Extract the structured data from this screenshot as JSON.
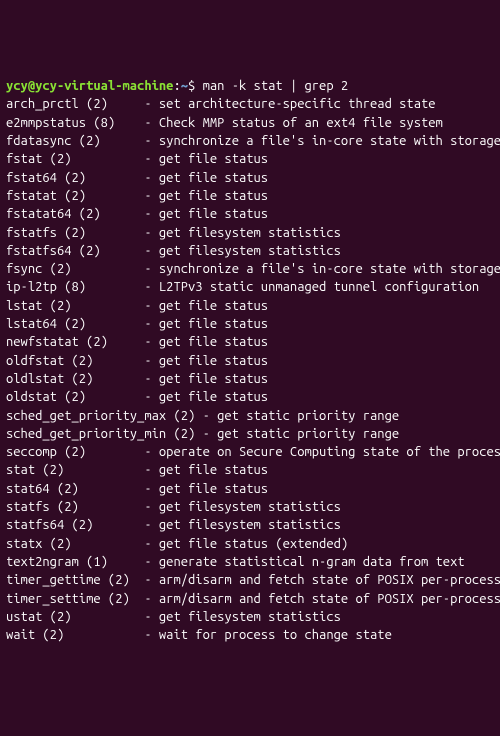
{
  "prompt": {
    "user": "ycy@ycy-virtual-machine",
    "colon": ":",
    "path": "~",
    "dollar": "$ "
  },
  "command": "man -k stat | grep 2",
  "entries": [
    {
      "name": "arch_prctl (2)     ",
      "sep": "- ",
      "desc": "set architecture-specific thread state"
    },
    {
      "name": "e2mmpstatus (8)    ",
      "sep": "- ",
      "desc": "Check MMP status of an ext4 file system"
    },
    {
      "name": "fdatasync (2)      ",
      "sep": "- ",
      "desc": "synchronize a file's in-core state with storage device"
    },
    {
      "name": "fstat (2)          ",
      "sep": "- ",
      "desc": "get file status"
    },
    {
      "name": "fstat64 (2)        ",
      "sep": "- ",
      "desc": "get file status"
    },
    {
      "name": "fstatat (2)        ",
      "sep": "- ",
      "desc": "get file status"
    },
    {
      "name": "fstatat64 (2)      ",
      "sep": "- ",
      "desc": "get file status"
    },
    {
      "name": "fstatfs (2)        ",
      "sep": "- ",
      "desc": "get filesystem statistics"
    },
    {
      "name": "fstatfs64 (2)      ",
      "sep": "- ",
      "desc": "get filesystem statistics"
    },
    {
      "name": "fsync (2)          ",
      "sep": "- ",
      "desc": "synchronize a file's in-core state with storage device"
    },
    {
      "name": "ip-l2tp (8)        ",
      "sep": "- ",
      "desc": "L2TPv3 static unmanaged tunnel configuration"
    },
    {
      "name": "lstat (2)          ",
      "sep": "- ",
      "desc": "get file status"
    },
    {
      "name": "lstat64 (2)        ",
      "sep": "- ",
      "desc": "get file status"
    },
    {
      "name": "newfstatat (2)     ",
      "sep": "- ",
      "desc": "get file status"
    },
    {
      "name": "oldfstat (2)       ",
      "sep": "- ",
      "desc": "get file status"
    },
    {
      "name": "oldlstat (2)       ",
      "sep": "- ",
      "desc": "get file status"
    },
    {
      "name": "oldstat (2)        ",
      "sep": "- ",
      "desc": "get file status"
    },
    {
      "name": "sched_get_priority_max (2) ",
      "sep": "- ",
      "desc": "get static priority range"
    },
    {
      "name": "sched_get_priority_min (2) ",
      "sep": "- ",
      "desc": "get static priority range"
    },
    {
      "name": "seccomp (2)        ",
      "sep": "- ",
      "desc": "operate on Secure Computing state of the process"
    },
    {
      "name": "stat (2)           ",
      "sep": "- ",
      "desc": "get file status"
    },
    {
      "name": "stat64 (2)         ",
      "sep": "- ",
      "desc": "get file status"
    },
    {
      "name": "statfs (2)         ",
      "sep": "- ",
      "desc": "get filesystem statistics"
    },
    {
      "name": "statfs64 (2)       ",
      "sep": "- ",
      "desc": "get filesystem statistics"
    },
    {
      "name": "statx (2)          ",
      "sep": "- ",
      "desc": "get file status (extended)"
    },
    {
      "name": "text2ngram (1)     ",
      "sep": "- ",
      "desc": "generate statistical n-gram data from text"
    },
    {
      "name": "timer_gettime (2)  ",
      "sep": "- ",
      "desc": "arm/disarm and fetch state of POSIX per-process timer"
    },
    {
      "name": "timer_settime (2)  ",
      "sep": "- ",
      "desc": "arm/disarm and fetch state of POSIX per-process timer"
    },
    {
      "name": "ustat (2)          ",
      "sep": "- ",
      "desc": "get filesystem statistics"
    },
    {
      "name": "wait (2)           ",
      "sep": "- ",
      "desc": "wait for process to change state"
    }
  ]
}
